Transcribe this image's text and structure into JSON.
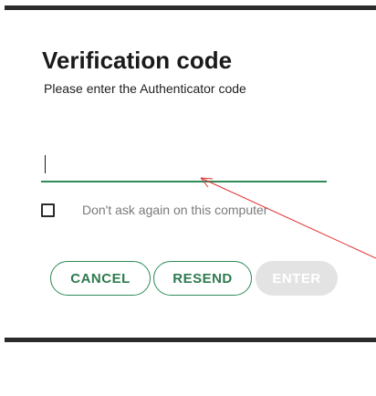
{
  "dialog": {
    "title": "Verification code",
    "subtitle": "Please enter the Authenticator code"
  },
  "code_input": {
    "value": "",
    "placeholder": ""
  },
  "remember": {
    "label": "Don't ask again on this computer",
    "checked": false
  },
  "buttons": {
    "cancel": "CANCEL",
    "resend": "RESEND",
    "enter": "ENTER",
    "enter_disabled": true
  },
  "colors": {
    "accent": "#2e8b57",
    "annotation_arrow": "#e03030",
    "disabled_button": "#e3e3e3"
  }
}
